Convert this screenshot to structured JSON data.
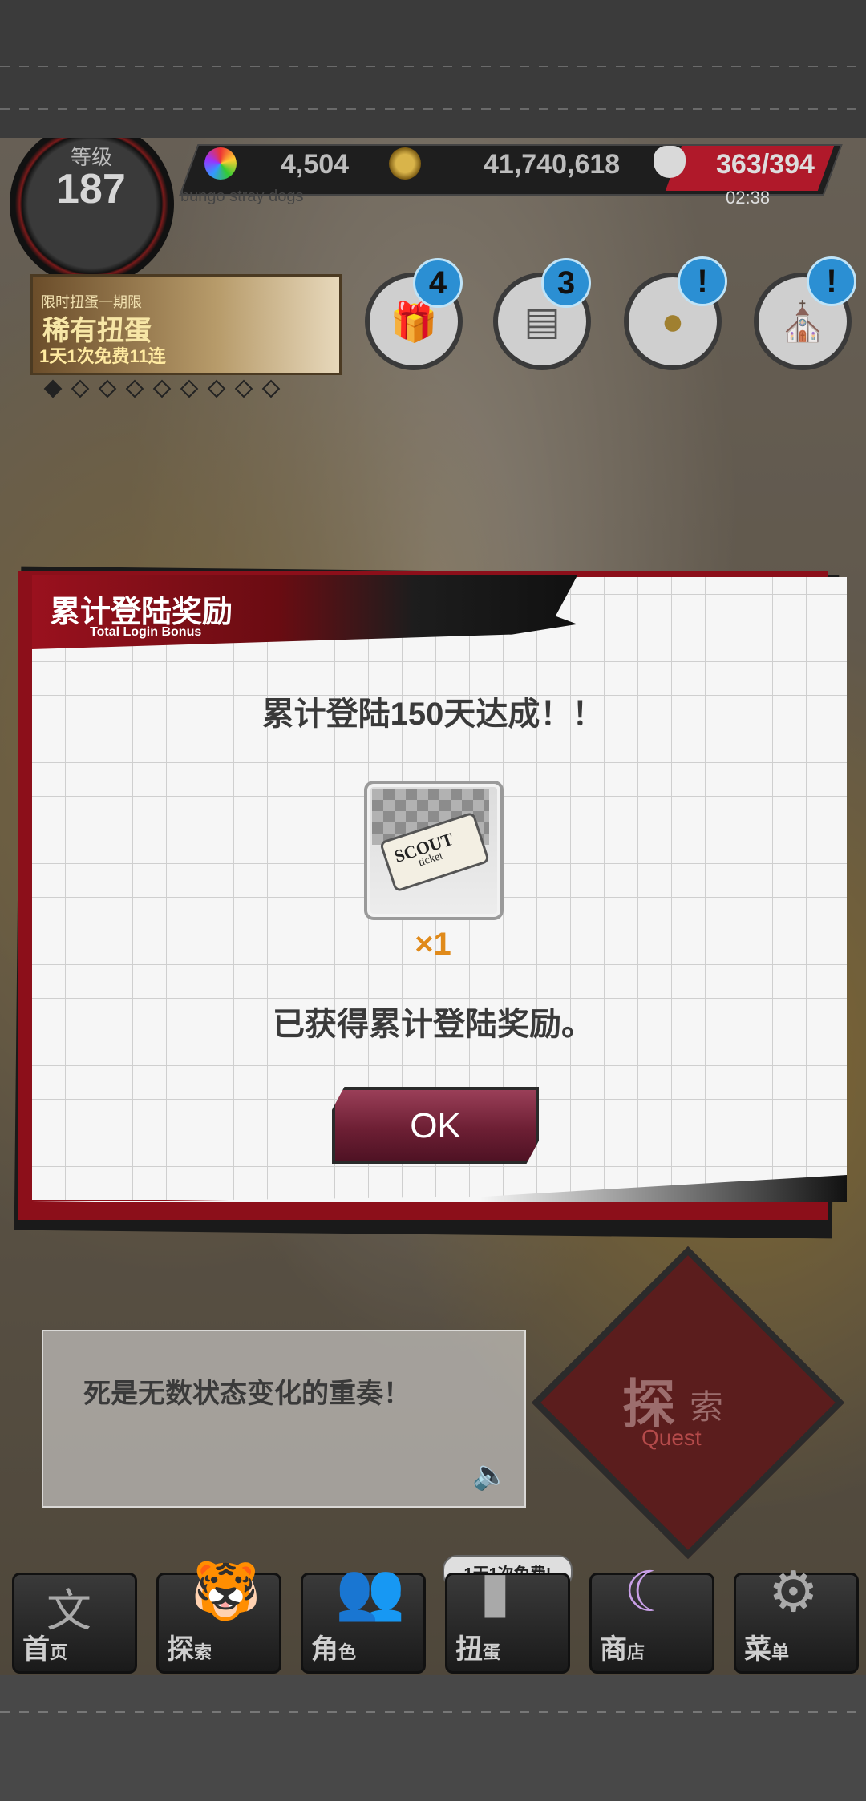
{
  "status_bar": {
    "level_label": "等级",
    "level_value": "187",
    "gems": "4,504",
    "coins": "41,740,618",
    "stamina": "363/394",
    "timer": "02:38",
    "game_subtitle": "bungo stray dogs"
  },
  "banner": {
    "line1": "限时扭蛋一期限",
    "line2": "稀有扭蛋",
    "line3": "1天1次免费11连"
  },
  "event_icons": [
    {
      "icon": "gift-icon",
      "badge": "4"
    },
    {
      "icon": "newspaper-icon",
      "badge": "3"
    },
    {
      "icon": "coin-tap-icon",
      "badge": "!"
    },
    {
      "icon": "building-icon",
      "badge": "!"
    }
  ],
  "modal": {
    "title": "累计登陆奖励",
    "subtitle": "Total Login Bonus",
    "achievement": "累计登陆150天达成！！",
    "item_name_line1": "SCOUT",
    "item_name_line2": "ticket",
    "item_quantity": "×1",
    "received_message": "已获得累计登陆奖励。",
    "ok_label": "OK"
  },
  "quote": {
    "text": "死是无数状态变化的重奏！"
  },
  "quest": {
    "label_main": "探",
    "label_small": "索",
    "label_en": "Quest"
  },
  "bottom_nav": {
    "free_tag": "1天1次免费!",
    "items": [
      {
        "label": "首",
        "small": "页",
        "icon": "home-bungo-icon"
      },
      {
        "label": "探",
        "small": "索",
        "icon": "tiger-icon"
      },
      {
        "label": "角",
        "small": "色",
        "icon": "characters-icon"
      },
      {
        "label": "扭",
        "small": "蛋",
        "icon": "gacha-icon"
      },
      {
        "label": "商",
        "small": "店",
        "icon": "shop-moon-icon"
      },
      {
        "label": "菜",
        "small": "单",
        "icon": "gear-icon"
      }
    ]
  },
  "colors": {
    "accent_red": "#8c0f1a",
    "ok_button": "#6d1f34",
    "quantity_orange": "#e08a1a",
    "badge_blue": "#2b8fd3"
  }
}
